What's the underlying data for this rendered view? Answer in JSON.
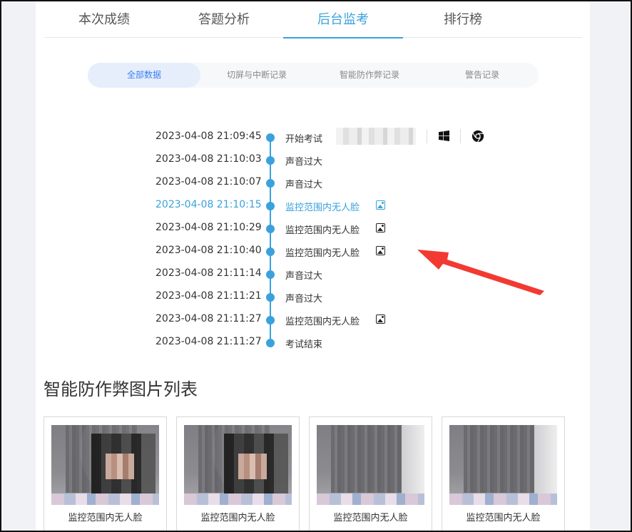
{
  "tabs": [
    {
      "label": "本次成绩",
      "active": false
    },
    {
      "label": "答题分析",
      "active": false
    },
    {
      "label": "后台监考",
      "active": true
    },
    {
      "label": "排行榜",
      "active": false
    }
  ],
  "subtabs": [
    {
      "label": "全部数据",
      "active": true
    },
    {
      "label": "切屏与中断记录",
      "active": false
    },
    {
      "label": "智能防作弊记录",
      "active": false
    },
    {
      "label": "警告记录",
      "active": false
    }
  ],
  "timeline": [
    {
      "time": "2023-04-08 21:09:45",
      "event": "开始考试",
      "has_image": false,
      "highlight": false
    },
    {
      "time": "2023-04-08 21:10:03",
      "event": "声音过大",
      "has_image": false,
      "highlight": false
    },
    {
      "time": "2023-04-08 21:10:07",
      "event": "声音过大",
      "has_image": false,
      "highlight": false
    },
    {
      "time": "2023-04-08 21:10:15",
      "event": "监控范围内无人脸",
      "has_image": true,
      "highlight": true
    },
    {
      "time": "2023-04-08 21:10:29",
      "event": "监控范围内无人脸",
      "has_image": true,
      "highlight": false
    },
    {
      "time": "2023-04-08 21:10:40",
      "event": "监控范围内无人脸",
      "has_image": true,
      "highlight": false
    },
    {
      "time": "2023-04-08 21:11:14",
      "event": "声音过大",
      "has_image": false,
      "highlight": false
    },
    {
      "time": "2023-04-08 21:11:21",
      "event": "声音过大",
      "has_image": false,
      "highlight": false
    },
    {
      "time": "2023-04-08 21:11:27",
      "event": "监控范围内无人脸",
      "has_image": true,
      "highlight": false
    },
    {
      "time": "2023-04-08 21:11:27",
      "event": "考试结束",
      "has_image": false,
      "highlight": false
    }
  ],
  "start_row_icons": [
    "windows-icon",
    "chrome-icon"
  ],
  "section_title": "智能防作弊图片列表",
  "pictures": [
    {
      "caption": "监控范围内无人脸",
      "has_person": true
    },
    {
      "caption": "监控范围内无人脸",
      "has_person": true
    },
    {
      "caption": "监控范围内无人脸",
      "has_person": false
    },
    {
      "caption": "监控范围内无人脸",
      "has_person": false
    }
  ],
  "colors": {
    "accent": "#3aa1dc",
    "subtab_active": "#3a7ff0",
    "annotation_arrow": "#f23a32"
  }
}
